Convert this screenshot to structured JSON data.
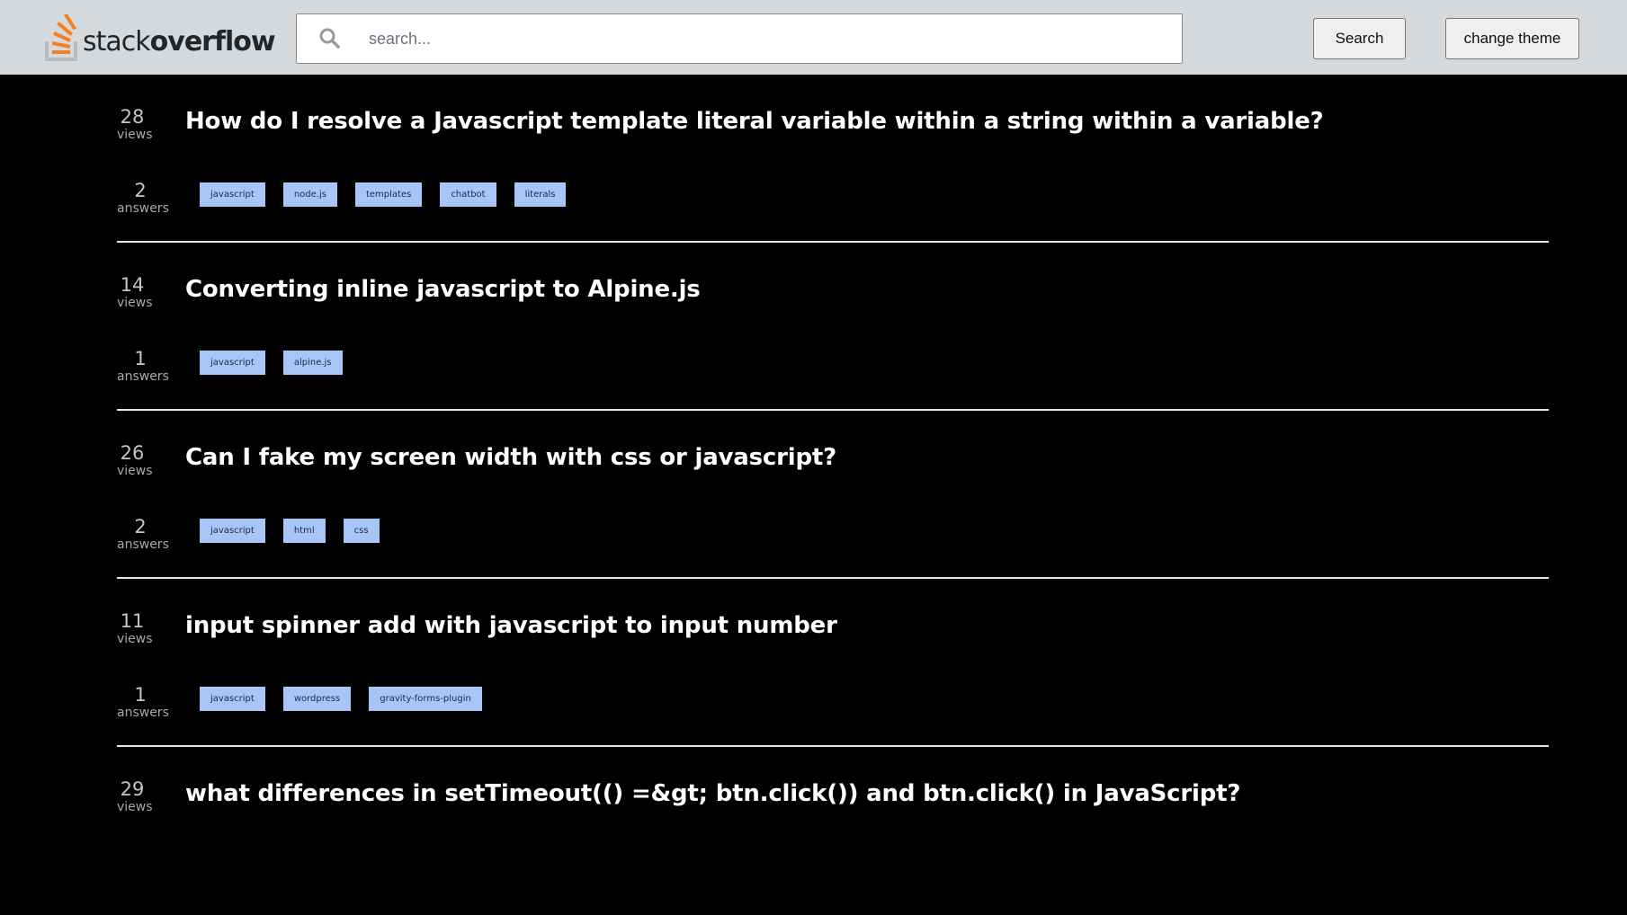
{
  "header": {
    "logo_text_light": "stack",
    "logo_text_bold": "overflow",
    "search_placeholder": "search...",
    "search_button": "Search",
    "theme_button": "change theme"
  },
  "colors": {
    "header_bg": "#d6d9dc",
    "page_bg": "#000000",
    "tag_bg": "#a8c5f7",
    "logo_orange": "#f48024"
  },
  "questions": [
    {
      "views": "28",
      "views_label": "views",
      "answers": "2",
      "answers_label": "answers",
      "title": "How do I resolve a Javascript template literal variable within a string within a variable?",
      "tags": [
        "javascript",
        "node.js",
        "templates",
        "chatbot",
        "literals"
      ]
    },
    {
      "views": "14",
      "views_label": "views",
      "answers": "1",
      "answers_label": "answers",
      "title": "Converting inline javascript to Alpine.js",
      "tags": [
        "javascript",
        "alpine.js"
      ]
    },
    {
      "views": "26",
      "views_label": "views",
      "answers": "2",
      "answers_label": "answers",
      "title": "Can I fake my screen width with css or javascript?",
      "tags": [
        "javascript",
        "html",
        "css"
      ]
    },
    {
      "views": "11",
      "views_label": "views",
      "answers": "1",
      "answers_label": "answers",
      "title": "input spinner add with javascript to input number",
      "tags": [
        "javascript",
        "wordpress",
        "gravity-forms-plugin"
      ]
    },
    {
      "views": "29",
      "views_label": "views",
      "title": "what differences in setTimeout(() =&gt; btn.click()) and btn.click() in JavaScript?"
    }
  ]
}
